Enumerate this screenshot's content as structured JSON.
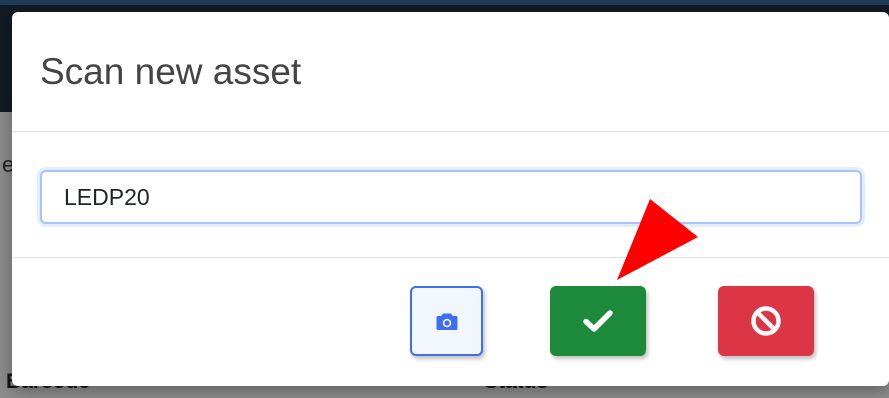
{
  "background": {
    "col_barcode": "Barcode",
    "col_status": "Status",
    "partial_letter": "e"
  },
  "modal": {
    "title": "Scan new asset",
    "input_value": "LEDP20"
  },
  "buttons": {
    "camera_icon": "camera-icon",
    "confirm_icon": "checkmark-icon",
    "cancel_icon": "ban-icon"
  },
  "colors": {
    "confirm": "#1d8a3b",
    "cancel": "#dc3545",
    "camera_border": "#3f6ff0",
    "annotation_arrow": "#ff0000"
  }
}
